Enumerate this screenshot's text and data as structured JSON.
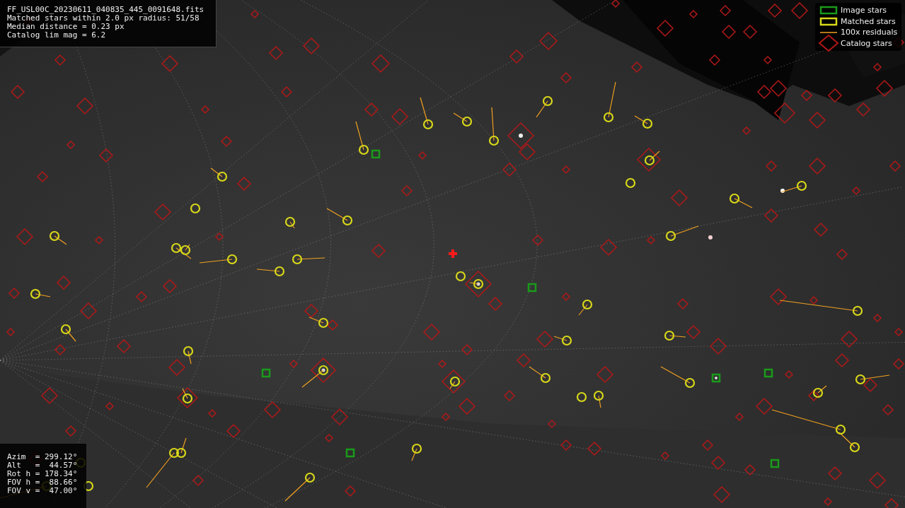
{
  "info_panel": {
    "lines": [
      "FF_USL00C_20230611_040835_445_0091648.fits",
      "Matched stars within 2.0 px radius: 51/58",
      "Median distance = 0.23 px",
      "Catalog lim mag = 6.2"
    ]
  },
  "legend": [
    {
      "label": "Image stars"
    },
    {
      "kind": "matched",
      "label": "Matched stars"
    },
    {
      "kind": "residual",
      "label": "100x residuals"
    },
    {
      "kind": "catalog",
      "label": "Catalog stars"
    }
  ],
  "pointing_panel": {
    "lines": [
      "Azim  = 299.12°",
      "Alt   =  44.57°",
      "Rot h = 178.34°",
      "FOV h =  88.66°",
      "FOV v =  47.00°"
    ]
  }
}
